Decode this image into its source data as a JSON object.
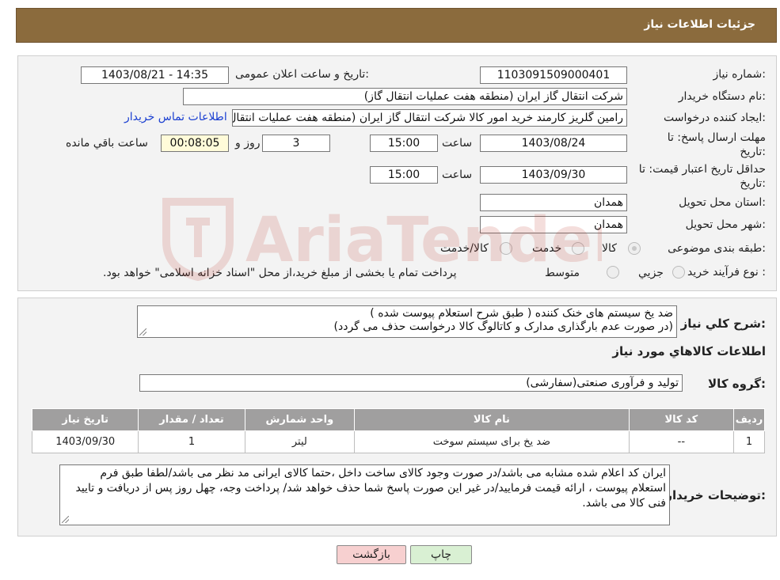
{
  "header": {
    "title": "جزئیات اطلاعات نیاز"
  },
  "labels": {
    "need_number": "شماره نیاز:",
    "announce_datetime": "تاریخ و ساعت اعلان عمومی:",
    "buyer_org": "نام دستگاه خریدار:",
    "requester": "ایجاد کننده درخواست:",
    "deadline_line1": "مهلت ارسال پاسخ: تا",
    "deadline_line2": "تاریخ:",
    "time_word": "ساعت",
    "day_and": "روز و",
    "remaining": "ساعت باقي مانده",
    "validity_line1": "حداقل تاریخ اعتبار قیمت: تا",
    "validity_line2": "تاریخ:",
    "province": "استان محل تحویل:",
    "city": "شهر محل تحویل:",
    "category": "طبقه بندی موضوعی:",
    "process_type": "نوع فرآیند خرید :",
    "need_summary": "شرح کلي نياز:",
    "goods_info": "اطلاعات کالاهاي مورد نياز",
    "goods_group": "گروه کالا:",
    "buyer_notes": "توضیحات خریدار:"
  },
  "values": {
    "need_number": "1103091509000401",
    "announce_datetime": "1403/08/21 - 14:35",
    "buyer_org": "شرکت انتقال گاز ایران (منطقه هفت عملیات انتقال گاز)",
    "requester": "رامین گلریز کارمند خرید امور کالا شرکت انتقال گاز ایران (منطقه هفت عملیات انتقال گاز)",
    "contact_link": "اطلاعات تماس خریدار",
    "deadline_date": "1403/08/24",
    "deadline_time": "15:00",
    "days_left": "3",
    "time_left": "00:08:05",
    "validity_date": "1403/09/30",
    "validity_time": "15:00",
    "province": "همدان",
    "city": "همدان",
    "need_summary_line1": "ضد یخ سیستم های خنک کننده ( طبق شرح استعلام پیوست شده )",
    "need_summary_line2": "(در صورت عدم بارگذاری مدارک و کاتالوگ کالا درخواست حذف می گردد)",
    "goods_group": "تولید و فرآوری صنعتی(سفارشی)",
    "buyer_notes": "ایران کد اعلام شده مشابه می باشد/در صورت وجود کالای ساخت داخل ،حتما کالای ایرانی مد نظر می باشد/لطفا طبق فرم استعلام پیوست ، ارائه قیمت فرمایید/در غیر این صورت پاسخ شما حذف خواهد شد/ پرداخت وجه، چهل روز پس از دریافت و تایید فنی کالا می باشد."
  },
  "category_options": [
    {
      "label": "کالا",
      "selected": true
    },
    {
      "label": "خدمت",
      "selected": false
    },
    {
      "label": "کالا/خدمت",
      "selected": false
    }
  ],
  "process_options": [
    {
      "label": "جزيي",
      "selected": false
    },
    {
      "label": "متوسط",
      "selected": false
    }
  ],
  "process_note": "پرداخت تمام یا بخشی از مبلغ خرید،از محل \"اسناد خزانه اسلامی\" خواهد بود.",
  "items_table": {
    "headers": [
      "ردیف",
      "کد کالا",
      "نام کالا",
      "واحد شمارش",
      "تعداد / مقدار",
      "تاریخ نیاز"
    ],
    "rows": [
      [
        "1",
        "--",
        "ضد یخ برای سیستم سوخت",
        "لیتر",
        "1",
        "1403/09/30"
      ]
    ]
  },
  "buttons": {
    "print": "چاپ",
    "back": "بازگشت"
  },
  "watermark": {
    "text": "AriaTender.neT",
    "color": "#c0392b"
  }
}
